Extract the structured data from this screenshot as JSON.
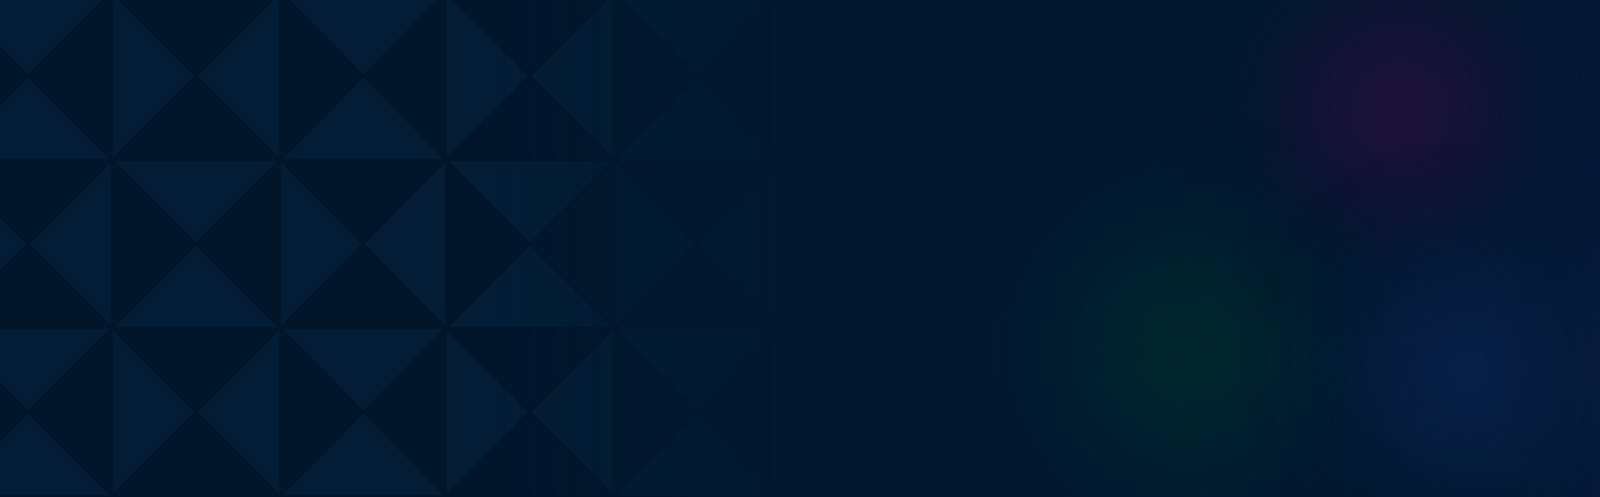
{
  "colors": {
    "background": "#011930",
    "pattern_light": "#03203a",
    "pattern_dark": "#011428",
    "glow_purple": "#1c1238",
    "glow_green": "#012a2e",
    "glow_blue": "#0a2250"
  }
}
